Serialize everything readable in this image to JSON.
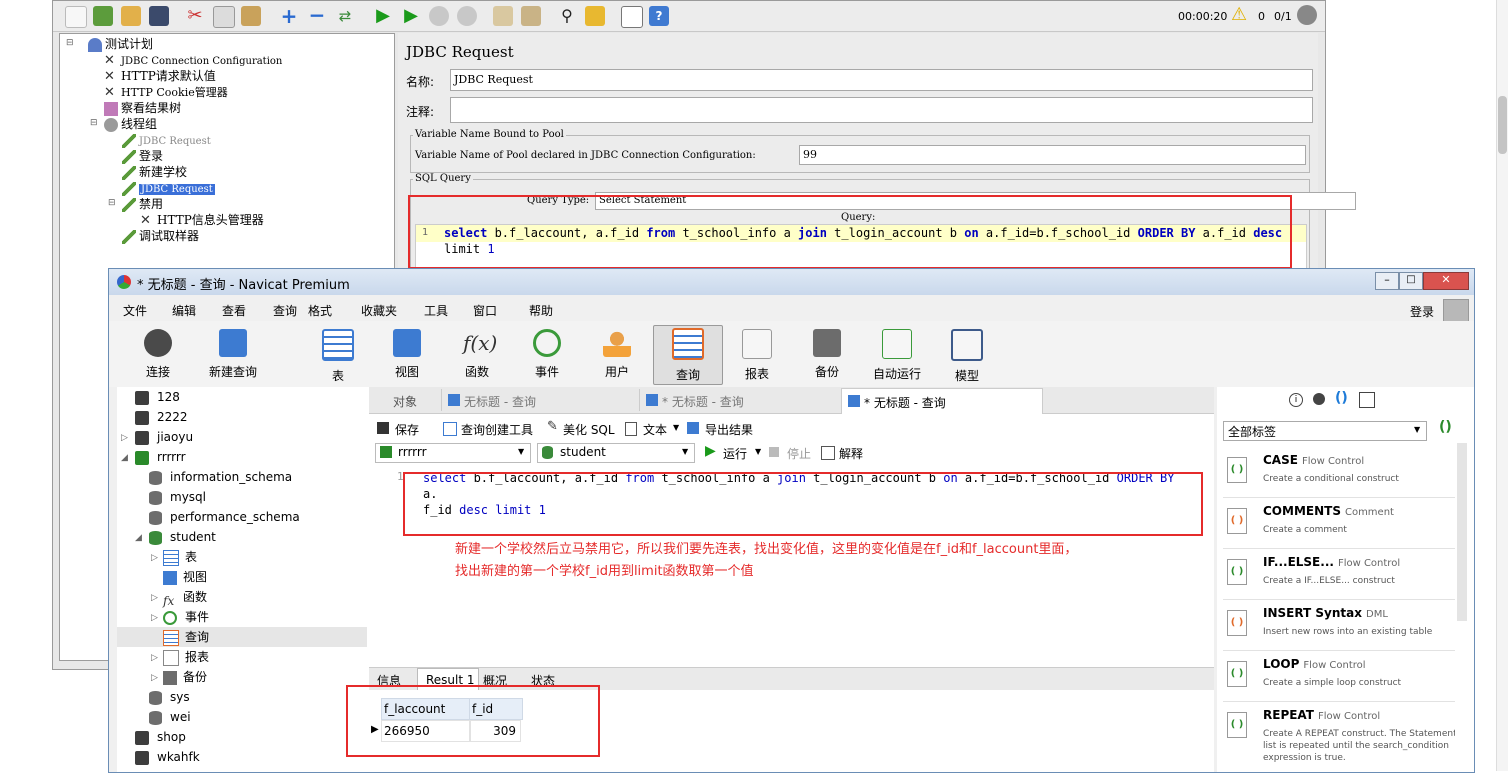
{
  "jmeter": {
    "timer": "00:00:20",
    "warning_count": "0",
    "threads": "0/1",
    "tree": [
      {
        "label": "测试计划"
      },
      {
        "label": "JDBC Connection Configuration"
      },
      {
        "label": "HTTP请求默认值"
      },
      {
        "label": "HTTP Cookie管理器"
      },
      {
        "label": "察看结果树"
      },
      {
        "label": "线程组"
      },
      {
        "label": "JDBC Request"
      },
      {
        "label": "登录"
      },
      {
        "label": "新建学校"
      },
      {
        "label": "JDBC Request"
      },
      {
        "label": "禁用"
      },
      {
        "label": "HTTP信息头管理器"
      },
      {
        "label": "调试取样器"
      }
    ],
    "panel_title": "JDBC Request",
    "name_label": "名称:",
    "name_value": "JDBC Request",
    "comment_label": "注释:",
    "pool_group_title": "Variable Name Bound to Pool",
    "pool_label": "Variable Name of Pool declared in JDBC Connection Configuration:",
    "pool_value": "99",
    "sql_group_title": "SQL Query",
    "query_type_label": "Query Type:",
    "query_type_value": "Select Statement",
    "query_label": "Query:",
    "line_number": "1",
    "sql": {
      "t1": "select",
      "t2": " b.f_laccount, a.f_id ",
      "t3": "from",
      "t4": " t_school_info a ",
      "t5": "join",
      "t6": " t_login_account b ",
      "t7": "on",
      "t8": " a.f_id=b.f_school_id  ",
      "t9": "ORDER BY",
      "t10": " a.f_id ",
      "t11": "desc",
      "t12": "limit",
      "t13": " 1"
    }
  },
  "navicat": {
    "title": "* 无标题 - 查询 - Navicat Premium",
    "menu": [
      "文件",
      "编辑",
      "查看",
      "查询",
      "格式",
      "收藏夹",
      "工具",
      "窗口",
      "帮助"
    ],
    "login": "登录",
    "tools": [
      "连接",
      "新建查询",
      "表",
      "视图",
      "函数",
      "事件",
      "用户",
      "查询",
      "报表",
      "备份",
      "自动运行",
      "模型"
    ],
    "tree": {
      "c1": "128",
      "c2": "2222",
      "c3": "jiaoyu",
      "c4": "rrrrrr",
      "d1": "information_schema",
      "d2": "mysql",
      "d3": "performance_schema",
      "d4": "student",
      "o1": "表",
      "o2": "视图",
      "o3": "函数",
      "o4": "事件",
      "o5": "查询",
      "o6": "报表",
      "o7": "备份",
      "d5": "sys",
      "d6": "wei",
      "c5": "shop",
      "c6": "wkahfk"
    },
    "tabs": {
      "objects": "对象",
      "tab1": "无标题 - 查询",
      "tab2": "* 无标题 - 查询",
      "tab3": "* 无标题 - 查询"
    },
    "query_toolbar": {
      "save": "保存",
      "builder": "查询创建工具",
      "beautify": "美化 SQL",
      "text": "文本",
      "export": "导出结果",
      "connection": "rrrrrr",
      "database": "student",
      "run": "运行",
      "stop": "停止",
      "explain": "解释"
    },
    "editor": {
      "line": "1",
      "annotation_line1": "新建一个学校然后立马禁用它，所以我们要先连表，找出变化值，这里的变化值是在f_id和f_laccount里面，",
      "annotation_line2": "找出新建的第一个学校f_id用到limit函数取第一个值"
    },
    "result_tabs": [
      "信息",
      "Result 1",
      "概况",
      "状态"
    ],
    "result": {
      "columns": [
        "f_laccount",
        "f_id"
      ],
      "rows": [
        [
          "266950",
          "309"
        ]
      ]
    },
    "snippets": {
      "tag_filter": "全部标签",
      "items": [
        {
          "title": "CASE",
          "category": "Flow Control",
          "desc": "Create a conditional construct"
        },
        {
          "title": "COMMENTS",
          "category": "Comment",
          "desc": "Create a comment"
        },
        {
          "title": "IF...ELSE...",
          "category": "Flow Control",
          "desc": "Create a IF...ELSE... construct"
        },
        {
          "title": "INSERT Syntax",
          "category": "DML",
          "desc": "Insert new rows into an existing table"
        },
        {
          "title": "LOOP",
          "category": "Flow Control",
          "desc": "Create a simple loop construct"
        },
        {
          "title": "REPEAT",
          "category": "Flow Control",
          "desc": "Create A REPEAT construct. The Statement list is repeated until the search_condition expression is true."
        }
      ]
    }
  }
}
